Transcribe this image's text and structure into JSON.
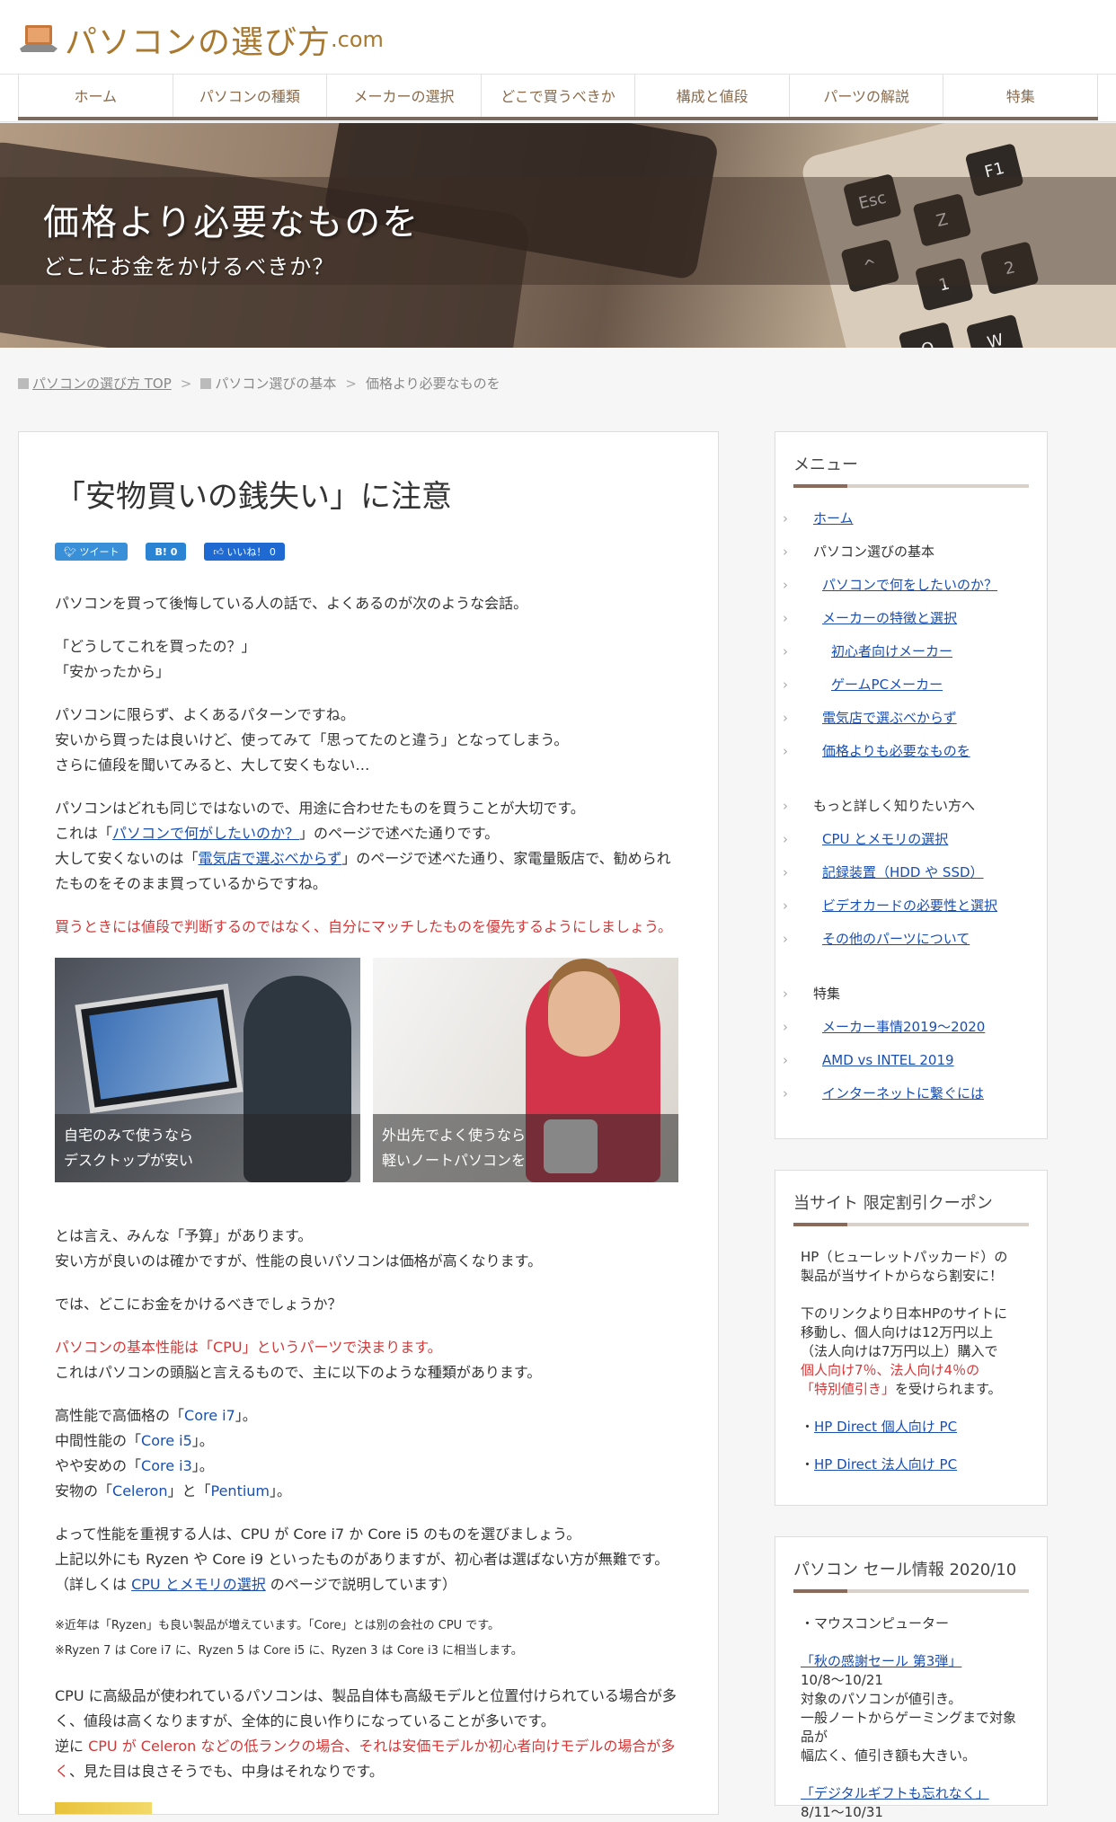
{
  "header": {
    "logo_text": "パソコンの選び方",
    "logo_suffix": ".com"
  },
  "nav": {
    "items": [
      "ホーム",
      "パソコンの種類",
      "メーカーの選択",
      "どこで買うべきか",
      "構成と値段",
      "パーツの解説",
      "特集"
    ]
  },
  "hero": {
    "title": "価格より必要なものを",
    "subtitle": "どこにお金をかけるべきか？",
    "keys": [
      "Esc",
      "Z",
      "F1",
      "^",
      "1",
      "2",
      "Q",
      "W"
    ]
  },
  "breadcrumb": {
    "home": "パソコンの選び方 TOP",
    "category": "パソコン選びの基本",
    "current": "価格より必要なものを"
  },
  "article": {
    "title": "「安物買いの銭失い」に注意",
    "share": {
      "tweet": "ツイート",
      "hatena": "B! 0",
      "like": "いいね！ 0"
    },
    "p1": "パソコンを買って後悔している人の話で、よくあるのが次のような会話。",
    "p2a": "「どうしてこれを買ったの？」",
    "p2b": "「安かったから」",
    "p3a": "パソコンに限らず、よくあるパターンですね。",
    "p3b": "安いから買ったは良いけど、使ってみて「思ってたのと違う」となってしまう。",
    "p3c": "さらに値段を聞いてみると、大して安くもない…",
    "p4a": "パソコンはどれも同じではないので、用途に合わせたものを買うことが大切です。",
    "p4b_pre": "これは「",
    "p4b_link": "パソコンで何がしたいのか？",
    "p4b_post": "」のページで述べた通りです。",
    "p4c_pre": "大して安くないのは「",
    "p4c_link": "電気店で選ぶべからず",
    "p4c_post": "」のページで述べた通り、家電量販店で、勧められ",
    "p4d": "たものをそのまま買っているからですね。",
    "p5": "買うときには値段で判断するのではなく、自分にマッチしたものを優先するようにしましょう。",
    "photo1_cap1": "自宅のみで使うなら",
    "photo1_cap2": "デスクトップが安い",
    "photo2_cap1": "外出先でよく使うなら",
    "photo2_cap2": "軽いノートパソコンを",
    "p6a": "とは言え、みんな「予算」があります。",
    "p6b": "安い方が良いのは確かですが、性能の良いパソコンは価格が高くなります。",
    "p7": "では、どこにお金をかけるべきでしょうか？",
    "p8a": "パソコンの基本性能は「CPU」というパーツで決まります。",
    "p8b": "これはパソコンの頭脳と言えるもので、主に以下のような種類があります。",
    "cpu1_pre": "高性能で高価格の「",
    "cpu1": "Core i7",
    "cpu1_post": "」。",
    "cpu2_pre": "中間性能の「",
    "cpu2": "Core i5",
    "cpu2_post": "」。",
    "cpu3_pre": "やや安めの「",
    "cpu3": "Core i3",
    "cpu3_post": "」。",
    "cpu4_pre": "安物の「",
    "cpu4a": "Celeron",
    "cpu4_mid": "」と「",
    "cpu4b": "Pentium",
    "cpu4_post": "」。",
    "p9a": "よって性能を重視する人は、CPU が Core i7 か Core i5 のものを選びましょう。",
    "p9b": "上記以外にも Ryzen や Core i9 といったものがありますが、初心者は選ばない方が無難です。",
    "p9c_pre": "（詳しくは ",
    "p9c_link": "CPU とメモリの選択",
    "p9c_post": " のページで説明しています）",
    "note1": "※近年は「Ryzen」も良い製品が増えています。「Core」とは別の会社の CPU です。",
    "note2": "※Ryzen 7 は Core i7 に、Ryzen 5 は Core i5 に、Ryzen 3 は Core i3 に相当します。",
    "p10a": "CPU に高級品が使われているパソコンは、製品自体も高級モデルと位置付けられている場合が多",
    "p10b": "く、値段は高くなりますが、全体的に良い作りになっていることが多いです。",
    "p10c_pre": "逆に ",
    "p10c_red": "CPU が Celeron などの低ランクの場合、それは安価モデルか初心者向けモデルの場合が多",
    "p10d_red": "く",
    "p10d_post": "、見た目は良さそうでも、中身はそれなりです。"
  },
  "sidebar": {
    "menu_title": "メニュー",
    "menu": [
      {
        "label": "ホーム",
        "level": 0,
        "link": true
      },
      {
        "label": "パソコン選びの基本",
        "level": 0,
        "link": false
      },
      {
        "label": "パソコンで何をしたいのか？",
        "level": 1,
        "link": true
      },
      {
        "label": "メーカーの特徴と選択",
        "level": 1,
        "link": true
      },
      {
        "label": "初心者向けメーカー",
        "level": 2,
        "link": true
      },
      {
        "label": "ゲームPCメーカー",
        "level": 2,
        "link": true
      },
      {
        "label": "電気店で選ぶべからず",
        "level": 1,
        "link": true
      },
      {
        "label": "価格よりも必要なものを",
        "level": 1,
        "link": true
      },
      {
        "label": "もっと詳しく知りたい方へ",
        "level": 0,
        "link": false,
        "gap": true
      },
      {
        "label": "CPU とメモリの選択",
        "level": 1,
        "link": true
      },
      {
        "label": "記録装置（HDD や SSD）",
        "level": 1,
        "link": true
      },
      {
        "label": "ビデオカードの必要性と選択",
        "level": 1,
        "link": true
      },
      {
        "label": "その他のパーツについて",
        "level": 1,
        "link": true
      },
      {
        "label": "特集",
        "level": 0,
        "link": false,
        "gap": true
      },
      {
        "label": "メーカー事情2019～2020",
        "level": 1,
        "link": true
      },
      {
        "label": "AMD vs INTEL 2019",
        "level": 1,
        "link": true
      },
      {
        "label": "インターネットに繋ぐには",
        "level": 1,
        "link": true
      }
    ],
    "coupon_title": "当サイト 限定割引クーポン",
    "coupon_l1": "HP（ヒューレットパッカード）の",
    "coupon_l2": "製品が当サイトからなら割安に！",
    "coupon_l3": "下のリンクより日本HPのサイトに",
    "coupon_l4": "移動し、個人向けは12万円以上",
    "coupon_l5": "（法人向けは7万円以上）購入で",
    "coupon_l6_red": "個人向け7％、法人向け4％の",
    "coupon_l7_red": "「特別値引き」",
    "coupon_l7_post": "を受けられます。",
    "coupon_link1": "HP Direct 個人向け PC",
    "coupon_link2": "HP Direct 法人向け PC",
    "bullet": "・",
    "sale_title": "パソコン セール情報 2020/10",
    "sale_maker": "・マウスコンピューター",
    "sale1_link": "「秋の感謝セール 第3弾」",
    "sale1_date": "10/8～10/21",
    "sale1_d1": "対象のパソコンが値引き。",
    "sale1_d2": "一般ノートからゲーミングまで対象品が",
    "sale1_d3": "幅広く、値引き額も大きい。",
    "sale2_link": "「デジタルギフトも忘れなく」",
    "sale2_date": "8/11～10/31"
  },
  "colors": {
    "accent": "#a8792f",
    "link": "#1a4fb0",
    "emphasis": "#d33838",
    "nav_border": "#7a6a60"
  }
}
